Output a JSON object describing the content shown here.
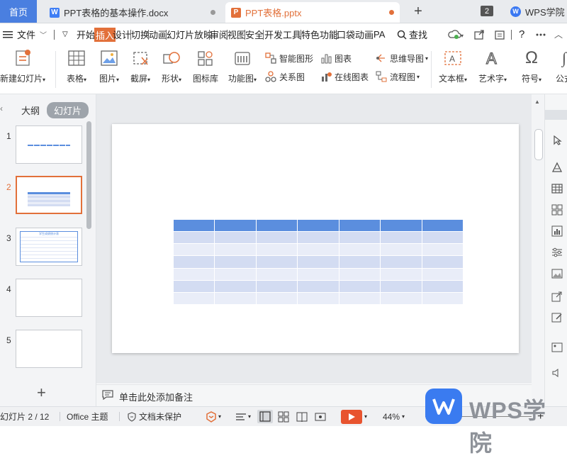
{
  "tabs": {
    "home": "首页",
    "doc_title": "PPT表格的基本操作.docx",
    "ppt_title": "PPT表格.pptx",
    "doc_icon": "W",
    "ppt_icon": "P",
    "window_count": "2",
    "academy": "WPS学院"
  },
  "menu": {
    "file": "文件",
    "items": [
      "开始",
      "插入",
      "设计",
      "切换",
      "动画",
      "幻灯片放映",
      "审阅",
      "视图",
      "安全",
      "开发工具",
      "特色功能",
      "口袋动画",
      "PA"
    ],
    "search": "查找"
  },
  "ribbon": {
    "new_slide": "新建幻灯片",
    "table": "表格",
    "picture": "图片",
    "screenshot": "截屏",
    "shape": "形状",
    "icon_lib": "图标库",
    "func_chart": "功能图",
    "smart_art": "智能图形",
    "chart": "图表",
    "mind_map": "思维导图",
    "relation": "关系图",
    "online_chart": "在线图表",
    "flowchart": "流程图",
    "textbox": "文本框",
    "wordart": "艺术字",
    "symbol": "符号",
    "formula": "公式"
  },
  "left_panel": {
    "outline": "大纲",
    "slides": "幻灯片",
    "thumb_numbers": [
      "1",
      "2",
      "3",
      "4",
      "5"
    ],
    "thumb3_title": "学生成绩统计表"
  },
  "notes": {
    "placeholder": "单击此处添加备注"
  },
  "status": {
    "slide_pos": "幻灯片 2 / 12",
    "theme": "Office 主题",
    "protect": "文档未保护",
    "zoom": "44%"
  },
  "watermark": {
    "text": "WPS学院"
  },
  "colors": {
    "accent": "#e2703a",
    "home_tab": "#4a7fe0",
    "table_header": "#5b8ede",
    "table_row_a": "#d3dcf2",
    "table_row_b": "#e9edf8"
  },
  "table": {
    "rows": 7,
    "cols": 7
  }
}
